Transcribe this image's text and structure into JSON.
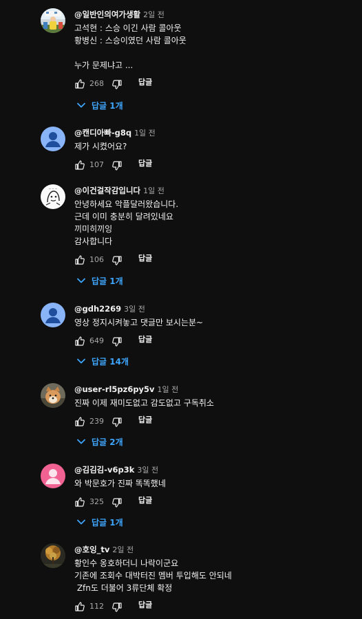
{
  "comments": [
    {
      "author": "@일반인의여가생활",
      "time": "2일 전",
      "text": "고석현 : 스승 이긴 사람 콜아웃\n황병신 : 스승이였던 사람 콜아웃\n\n누가 문제냐고 ...",
      "likes": "268",
      "reply_label": "답글",
      "replies_label": "답글 1개",
      "avatar": "photo-avatar"
    },
    {
      "author": "@캔디아빠-g8q",
      "time": "1일 전",
      "text": "제가 시켰어요?",
      "likes": "107",
      "reply_label": "답글",
      "replies_label": "",
      "avatar": "default-user-avatar"
    },
    {
      "author": "@이건걸작감입니다",
      "time": "1일 전",
      "text": "안녕하세요 악플달러왔습니다.\n근데 이미 충분히 달려있네요\n끼미히끼잉\n감사합니다",
      "likes": "106",
      "reply_label": "답글",
      "replies_label": "답글 1개",
      "avatar": "drawing-avatar"
    },
    {
      "author": "@gdh2269",
      "time": "3일 전",
      "text": "영상 정지시켜놓고 댓글만 보시는분~",
      "likes": "649",
      "reply_label": "답글",
      "replies_label": "답글 14개",
      "avatar": "default-user-avatar"
    },
    {
      "author": "@user-rl5pz6py5v",
      "time": "1일 전",
      "text": "진짜 이제 재미도없고 감도없고 구독취소",
      "likes": "239",
      "reply_label": "답글",
      "replies_label": "답글 2개",
      "avatar": "dog-photo-avatar"
    },
    {
      "author": "@김김김-v6p3k",
      "time": "3일 전",
      "text": "와 박문호가 진짜 똑똑했네",
      "likes": "325",
      "reply_label": "답글",
      "replies_label": "답글 1개",
      "avatar": "default-user-avatar-pink"
    },
    {
      "author": "@호잉_tv",
      "time": "2일 전",
      "text": "황인수 옹호하더니 나락이군요\n기존에 조회수 대박터진 멤버 투입해도 안되네\n Zfn도 더불어 3류단체 확정",
      "likes": "112",
      "reply_label": "답글",
      "replies_label": "",
      "avatar": "tree-photo-avatar"
    }
  ],
  "colors": {
    "background": "#0f0f0f",
    "text": "#f1f1f1",
    "secondary_text": "#aaaaaa",
    "link_blue": "#3ea6ff",
    "default_avatar_blue": "#8ab4f8",
    "default_avatar_pink": "#f06292"
  }
}
